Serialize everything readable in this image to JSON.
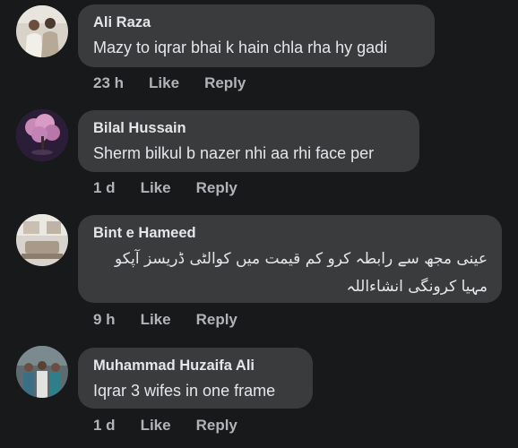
{
  "comments": [
    {
      "author": "Ali Raza",
      "text": "Mazy to iqrar bhai k hain chla rha hy gadi",
      "time": "23 h",
      "like": "Like",
      "reply": "Reply",
      "avatar": "couple-photo-avatar"
    },
    {
      "author": "Bilal Hussain",
      "text": "Sherm bilkul b nazer nhi aa rhi face per",
      "time": "1 d",
      "like": "Like",
      "reply": "Reply",
      "avatar": "pink-tree-avatar"
    },
    {
      "author": "Bint e Hameed",
      "text": "عینی مجھ سے رابطہ کرو کم قیمت میں کوالٹی ڈریسز آپکو مہیا کرونگی انشاءاللہ",
      "time": "9 h",
      "like": "Like",
      "reply": "Reply",
      "avatar": "room-interior-avatar"
    },
    {
      "author": "Muhammad Huzaifa Ali",
      "text": "Iqrar 3 wifes in one frame",
      "time": "1 d",
      "like": "Like",
      "reply": "Reply",
      "avatar": "group-photo-avatar"
    }
  ],
  "colors": {
    "background": "#18191a",
    "bubble": "#3a3b3c",
    "primary_text": "#e4e6eb",
    "secondary_text": "#b0b3b8"
  }
}
